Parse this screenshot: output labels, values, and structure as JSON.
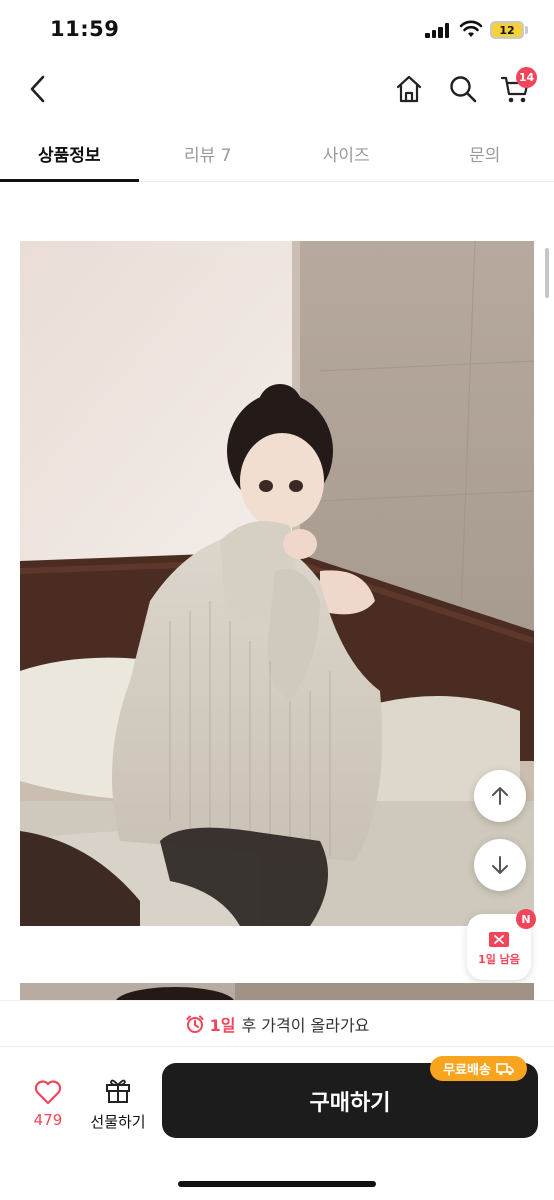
{
  "status_bar": {
    "time": "11:59",
    "battery": "12"
  },
  "nav": {
    "cart_count": "14"
  },
  "tabs": [
    {
      "label": "상품정보",
      "active": true
    },
    {
      "label": "리뷰 7",
      "active": false
    },
    {
      "label": "사이즈",
      "active": false
    },
    {
      "label": "문의",
      "active": false
    }
  ],
  "coupon": {
    "badge": "N",
    "label": "1일 남음"
  },
  "notice": {
    "highlight": "1일",
    "text": "후 가격이 올라가요"
  },
  "bottom": {
    "like_count": "479",
    "gift_label": "선물하기",
    "buy_label": "구매하기",
    "shipping_label": "무료배송"
  },
  "colors": {
    "accent": "#f2455a",
    "buy_button": "#1c1c1c",
    "shipping_badge": "#f8a41e"
  }
}
